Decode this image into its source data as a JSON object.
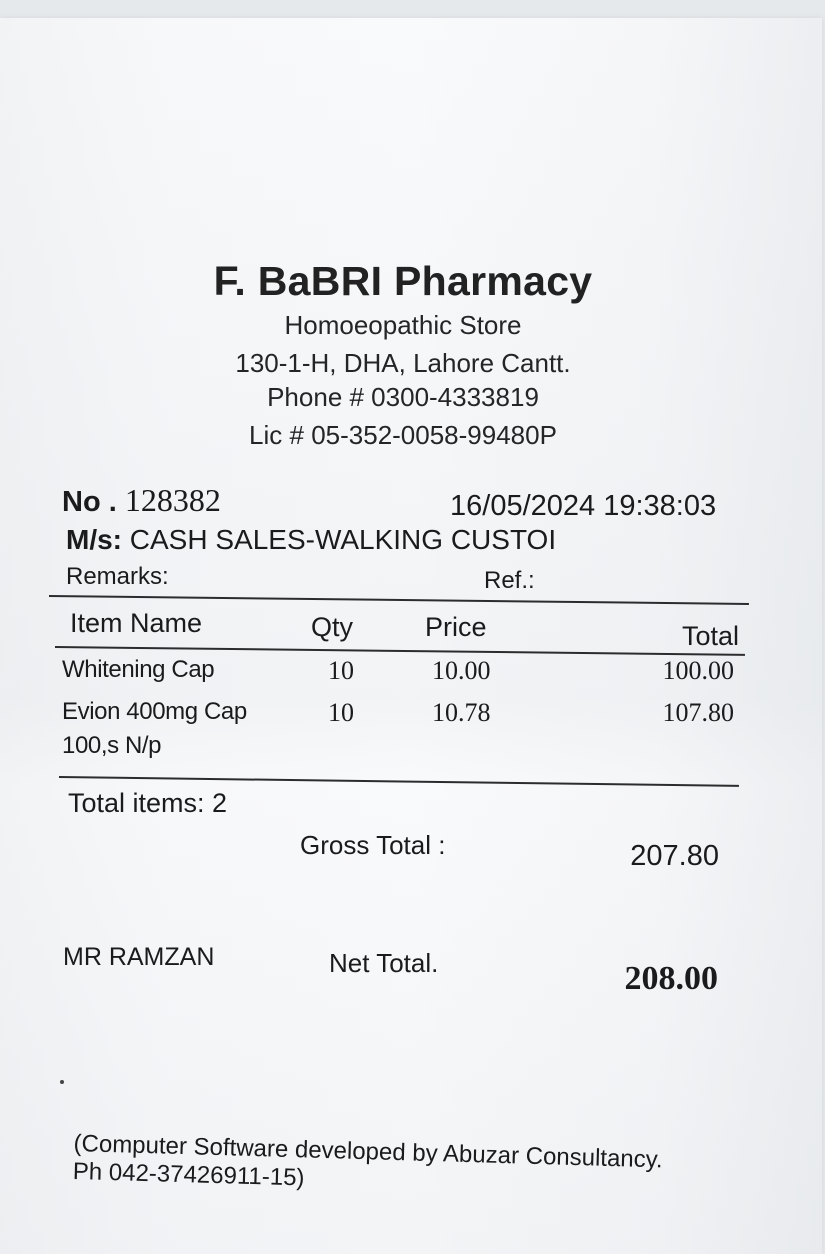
{
  "store": {
    "name": "F. BaBRI Pharmacy",
    "type": "Homoeopathic Store",
    "address": "130-1-H, DHA, Lahore Cantt.",
    "phone": "Phone # 0300-4333819",
    "license": "Lic # 05-352-0058-99480P"
  },
  "invoice": {
    "number_label": "No .",
    "number": "128382",
    "datetime": "16/05/2024 19:38:03",
    "customer_label": "M/s:",
    "customer": "CASH SALES-WALKING CUSTOI",
    "remarks_label": "Remarks:",
    "ref_label": "Ref.:"
  },
  "table": {
    "headers": {
      "item_name": "Item Name",
      "qty": "Qty",
      "price": "Price",
      "total": "Total"
    },
    "rows": [
      {
        "name": "Whitening Cap",
        "name_line2": "",
        "qty": "10",
        "price": "10.00",
        "total": "100.00"
      },
      {
        "name": "Evion 400mg Cap",
        "name_line2": "100,s N/p",
        "qty": "10",
        "price": "10.78",
        "total": "107.80"
      }
    ]
  },
  "summary": {
    "total_items": "Total items: 2",
    "gross_total_label": "Gross Total :",
    "gross_total": "207.80",
    "cashier": "MR RAMZAN",
    "net_total_label": "Net Total.",
    "net_total": "208.00"
  },
  "footer": {
    "line1": "(Computer Software developed by Abuzar Consultancy.",
    "line2": "Ph 042-37426911-15)"
  }
}
